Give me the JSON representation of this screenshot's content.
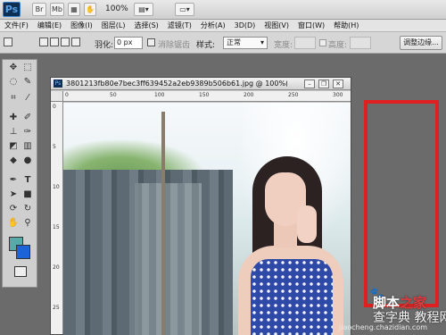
{
  "app": {
    "logo": "Ps",
    "zoom": "100%",
    "app_buttons": [
      "Br",
      "Mb",
      "grid-icon",
      "hand-icon",
      "zoom-icon",
      "rotate-icon",
      "arrange-icon",
      "screen-mode-icon"
    ]
  },
  "menu": {
    "items": [
      "文件(F)",
      "编辑(E)",
      "图像(I)",
      "图层(L)",
      "选择(S)",
      "滤镜(T)",
      "分析(A)",
      "3D(D)",
      "视图(V)",
      "窗口(W)",
      "帮助(H)"
    ]
  },
  "options": {
    "feather_label": "羽化:",
    "feather_value": "0 px",
    "antialias_label": "消除锯齿",
    "style_label": "样式:",
    "style_value": "正常",
    "width_label": "宽度:",
    "height_label": "高度:",
    "refine_edge_button": "调整边缘..."
  },
  "toolbox": {
    "tools": [
      "move-tool",
      "marquee-tool",
      "lasso-tool",
      "quick-select-tool",
      "crop-tool",
      "eyedropper-tool",
      "healing-tool",
      "brush-tool",
      "clone-stamp-tool",
      "history-brush-tool",
      "eraser-tool",
      "gradient-tool",
      "blur-tool",
      "dodge-tool",
      "pen-tool",
      "type-tool",
      "path-select-tool",
      "shape-tool",
      "3d-rotate-tool",
      "3d-orbit-tool",
      "hand-tool",
      "zoom-tool"
    ],
    "foreground_color": "#56aaa7",
    "background_color": "#1d63d8"
  },
  "document": {
    "title": "3801213fb80e7bec3ff639452a2eb9389b506b61.jpg @ 100%(RG...",
    "ruler_h": [
      "0",
      "50",
      "100",
      "150",
      "200",
      "250",
      "300"
    ],
    "ruler_v": [
      "0",
      "5",
      "10",
      "15",
      "20",
      "25"
    ]
  },
  "watermark": {
    "logo_part1": "脚本",
    "logo_part2": "之家",
    "text": "查字典 教程网",
    "url": "jiaocheng.chazidian.com"
  },
  "colors": {
    "highlight_box": "#e02020",
    "accent": "#3b82c8"
  }
}
